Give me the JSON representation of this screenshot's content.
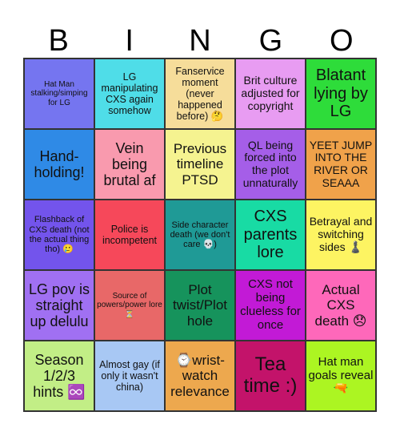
{
  "header": {
    "letters": [
      "B",
      "I",
      "N",
      "G",
      "O"
    ]
  },
  "cells": [
    {
      "text": "Hat Man stalking/simping for LG",
      "color": "#7575f0"
    },
    {
      "text": "LG manipulating CXS again somehow",
      "color": "#4fdde8"
    },
    {
      "text": "Fanservice moment (never happened before) 🤔",
      "color": "#f6dd9a"
    },
    {
      "text": "Brit culture adjusted for copyright",
      "color": "#e89cf2"
    },
    {
      "text": "Blatant lying by LG",
      "color": "#2edc3a"
    },
    {
      "text": "Hand-holding!",
      "color": "#2f8ae6"
    },
    {
      "text": "Vein being brutal af",
      "color": "#f99aae"
    },
    {
      "text": "Previous timeline PTSD",
      "color": "#f5f390"
    },
    {
      "text": "QL being forced into the plot unnaturally",
      "color": "#a55ee8"
    },
    {
      "text": "YEET JUMP INTO THE RIVER OR SEAAA",
      "color": "#f0a24a"
    },
    {
      "text": "Flashback of CXS death (not the actual thing tho) 🥲",
      "color": "#7354ec"
    },
    {
      "text": "Police is incompetent",
      "color": "#f6485a"
    },
    {
      "text": "Side character death (we don't care 💀)",
      "color": "#1f9a96"
    },
    {
      "text": "CXS parents lore",
      "color": "#18dba4"
    },
    {
      "text": "Betrayal and switching sides ♟️",
      "color": "#fdf462"
    },
    {
      "text": "LG pov is straight up delulu",
      "color": "#a070f2"
    },
    {
      "text": "Source of powers/power lore ⏳",
      "color": "#e86868"
    },
    {
      "text": "Plot twist/Plot hole",
      "color": "#16935c"
    },
    {
      "text": "CXS not being clueless for once",
      "color": "#c21ad6"
    },
    {
      "text": "Actual CXS death 😞",
      "color": "#fe68ba"
    },
    {
      "text": "Season 1/2/3 hints ♾️",
      "color": "#c2ee86"
    },
    {
      "text": "Almost gay (if only it wasn't china)",
      "color": "#a8c8f4"
    },
    {
      "text": "⌚wrist-watch relevance",
      "color": "#eda84e"
    },
    {
      "text": "Tea time :)",
      "color": "#c3136a"
    },
    {
      "text": "Hat man goals reveal 🔫",
      "color": "#acf522"
    }
  ]
}
